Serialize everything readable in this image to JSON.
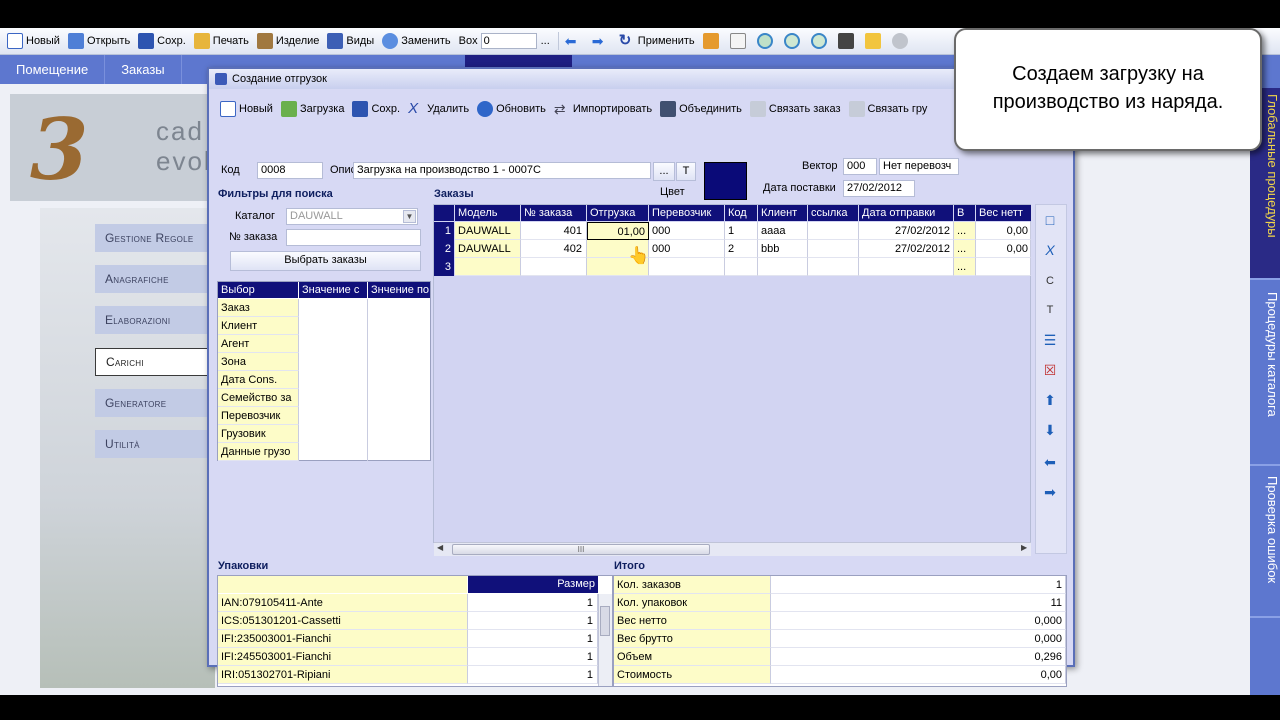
{
  "toolbar": {
    "items": [
      {
        "label": "Новый",
        "icon": "new-icon"
      },
      {
        "label": "Открыть",
        "icon": "open-icon"
      },
      {
        "label": "Сохр.",
        "icon": "save-icon"
      },
      {
        "label": "Печать",
        "icon": "print-icon"
      },
      {
        "label": "Изделие",
        "icon": "product-icon"
      },
      {
        "label": "Виды",
        "icon": "views-icon"
      },
      {
        "label": "Заменить",
        "icon": "replace-icon"
      }
    ],
    "box_label": "Box",
    "box_value": "0",
    "ellipsis": "...",
    "apply_label": "Применить"
  },
  "nav": {
    "tabs": [
      "Помещение",
      "Заказы"
    ]
  },
  "logo": {
    "text1": "cad",
    "text2": "evol",
    "letter": "3"
  },
  "left_menu": [
    "Gestione Regole",
    "Anagrafiche",
    "Elaborazioni",
    "Carichi",
    "Generatore",
    "Utilità"
  ],
  "right_tabs": [
    "Глобальные процедуры",
    "Процедуры каталога",
    "Проверка ошибок"
  ],
  "tooltip": {
    "line1": "Создаем загрузку на",
    "line2": "производство из наряда."
  },
  "dialog": {
    "title": "Создание отгрузок",
    "toolbar": [
      "Новый",
      "Загрузка",
      "Сохр.",
      "Удалить",
      "Обновить",
      "Импортировать",
      "Объединить",
      "Связать заказ",
      "Связать гру"
    ],
    "code_label": "Код",
    "code_value": "0008",
    "desc_label": "Опис",
    "desc_value": "Загрузка на производство 1 - 0007C",
    "ellipsis": "...",
    "t_button": "T",
    "color_label": "Цвет",
    "color_value": "#0a0a78",
    "vector_label": "Вектор",
    "vector_value": "000",
    "carrier_value": "Нет перевозч",
    "delivery_label": "Дата поставки",
    "delivery_value": "27/02/2012",
    "filters": {
      "title": "Фильтры для поиска",
      "catalog_label": "Каталог",
      "catalog_value": "DAUWALL",
      "order_label": "№ заказа",
      "order_value": "",
      "select_button": "Выбрать заказы"
    },
    "selection": {
      "headers": [
        "Выбор",
        "Значение с",
        "Знчение по"
      ],
      "rows": [
        "Заказ",
        "Клиент",
        "Агент",
        "Зона",
        "Дата Cons.",
        "Семейство за",
        "Перевозчик",
        "Грузовик",
        "Данные грузо"
      ]
    },
    "orders": {
      "title": "Заказы",
      "headers": [
        "Модель",
        "№ заказа",
        "Отгрузка",
        "Перевозчик",
        "Код",
        "Клиент",
        "ссылка",
        "Дата отправки",
        "В",
        "Вес нетт"
      ],
      "rows": [
        {
          "n": "1",
          "cells": [
            "DAUWALL",
            "401",
            "01,00",
            "000",
            "1",
            "aaaa",
            "",
            "27/02/2012",
            "...",
            "0,00"
          ]
        },
        {
          "n": "2",
          "cells": [
            "DAUWALL",
            "402",
            "",
            "000",
            "2",
            "bbb",
            "",
            "27/02/2012",
            "...",
            "0,00"
          ]
        },
        {
          "n": "3",
          "cells": [
            "",
            "",
            "",
            "",
            "",
            "",
            "",
            "",
            "...",
            ""
          ]
        }
      ],
      "scroll_mid": "III"
    },
    "side_buttons": [
      "С",
      "Т"
    ],
    "packages": {
      "title": "Упаковки",
      "size_header": "Размер",
      "rows": [
        {
          "name": "IAN:079105411-Ante",
          "size": "1"
        },
        {
          "name": "ICS:051301201-Cassetti",
          "size": "1"
        },
        {
          "name": "IFI:235003001-Fianchi",
          "size": "1"
        },
        {
          "name": "IFI:245503001-Fianchi",
          "size": "1"
        },
        {
          "name": "IRI:051302701-Ripiani",
          "size": "1"
        }
      ]
    },
    "totals": {
      "title": "Итого",
      "rows": [
        {
          "label": "Кол. заказов",
          "value": "1"
        },
        {
          "label": "Кол. упаковок",
          "value": "11"
        },
        {
          "label": "Вес нетто",
          "value": "0,000"
        },
        {
          "label": "Вес брутто",
          "value": "0,000"
        },
        {
          "label": "Объем",
          "value": "0,296"
        },
        {
          "label": "Стоимость",
          "value": "0,00"
        }
      ]
    }
  }
}
